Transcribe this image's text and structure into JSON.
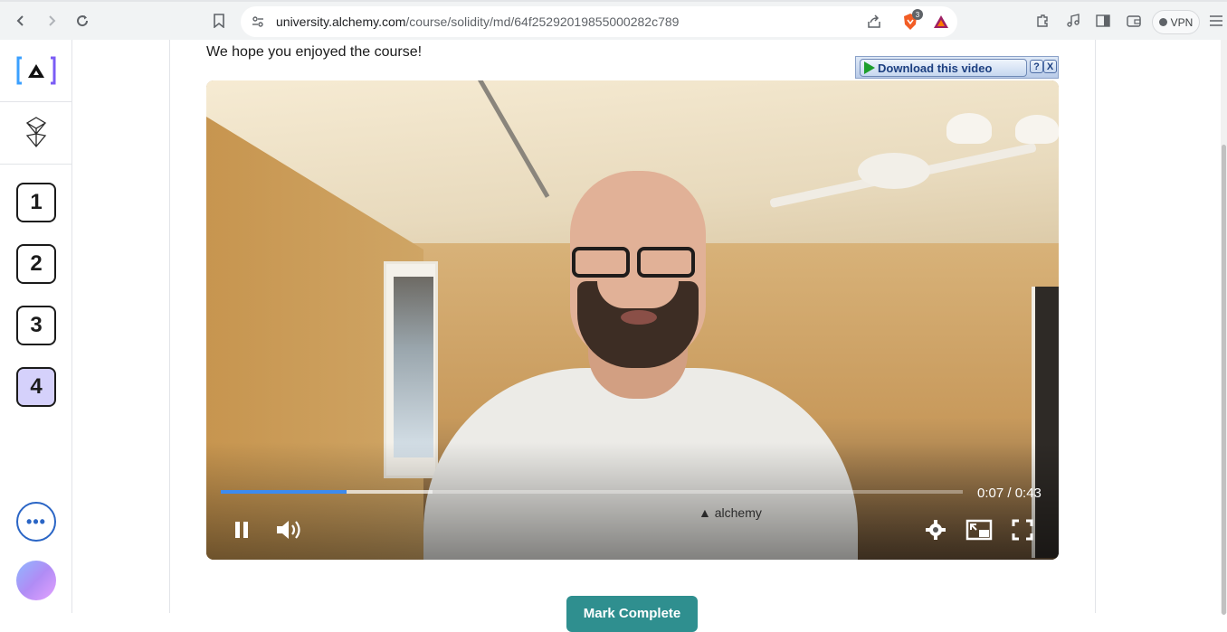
{
  "browser": {
    "url_host": "university.alchemy.com",
    "url_path": "/course/solidity/md/64f25292019855000282c789",
    "brave_badge": "3",
    "vpn_label": "VPN"
  },
  "sidebar": {
    "steps": [
      {
        "label": "1",
        "active": false
      },
      {
        "label": "2",
        "active": false
      },
      {
        "label": "3",
        "active": false
      },
      {
        "label": "4",
        "active": true
      }
    ],
    "more_label": "•••"
  },
  "content": {
    "intro_text": "We hope you enjoyed the course!",
    "mark_complete_label": "Mark Complete"
  },
  "download_bar": {
    "label": "Download this video",
    "help": "?",
    "close": "X"
  },
  "video": {
    "current_time": "0:07",
    "duration": "0:43",
    "time_display": "0:07 / 0:43",
    "played_fraction": 0.17,
    "buffered_fraction": 0.285,
    "shirt_logo": "alchemy",
    "accent_color": "#3d8bef"
  },
  "icons": [
    "back-icon",
    "forward-icon",
    "reload-icon",
    "bookmark-icon",
    "site-settings-icon",
    "share-icon",
    "brave-shields-icon",
    "brave-rewards-icon",
    "extensions-icon",
    "media-icon",
    "sidebar-icon",
    "wallet-icon",
    "menu-icon",
    "pause-icon",
    "volume-icon",
    "settings-icon",
    "picture-in-picture-icon",
    "fullscreen-icon"
  ]
}
